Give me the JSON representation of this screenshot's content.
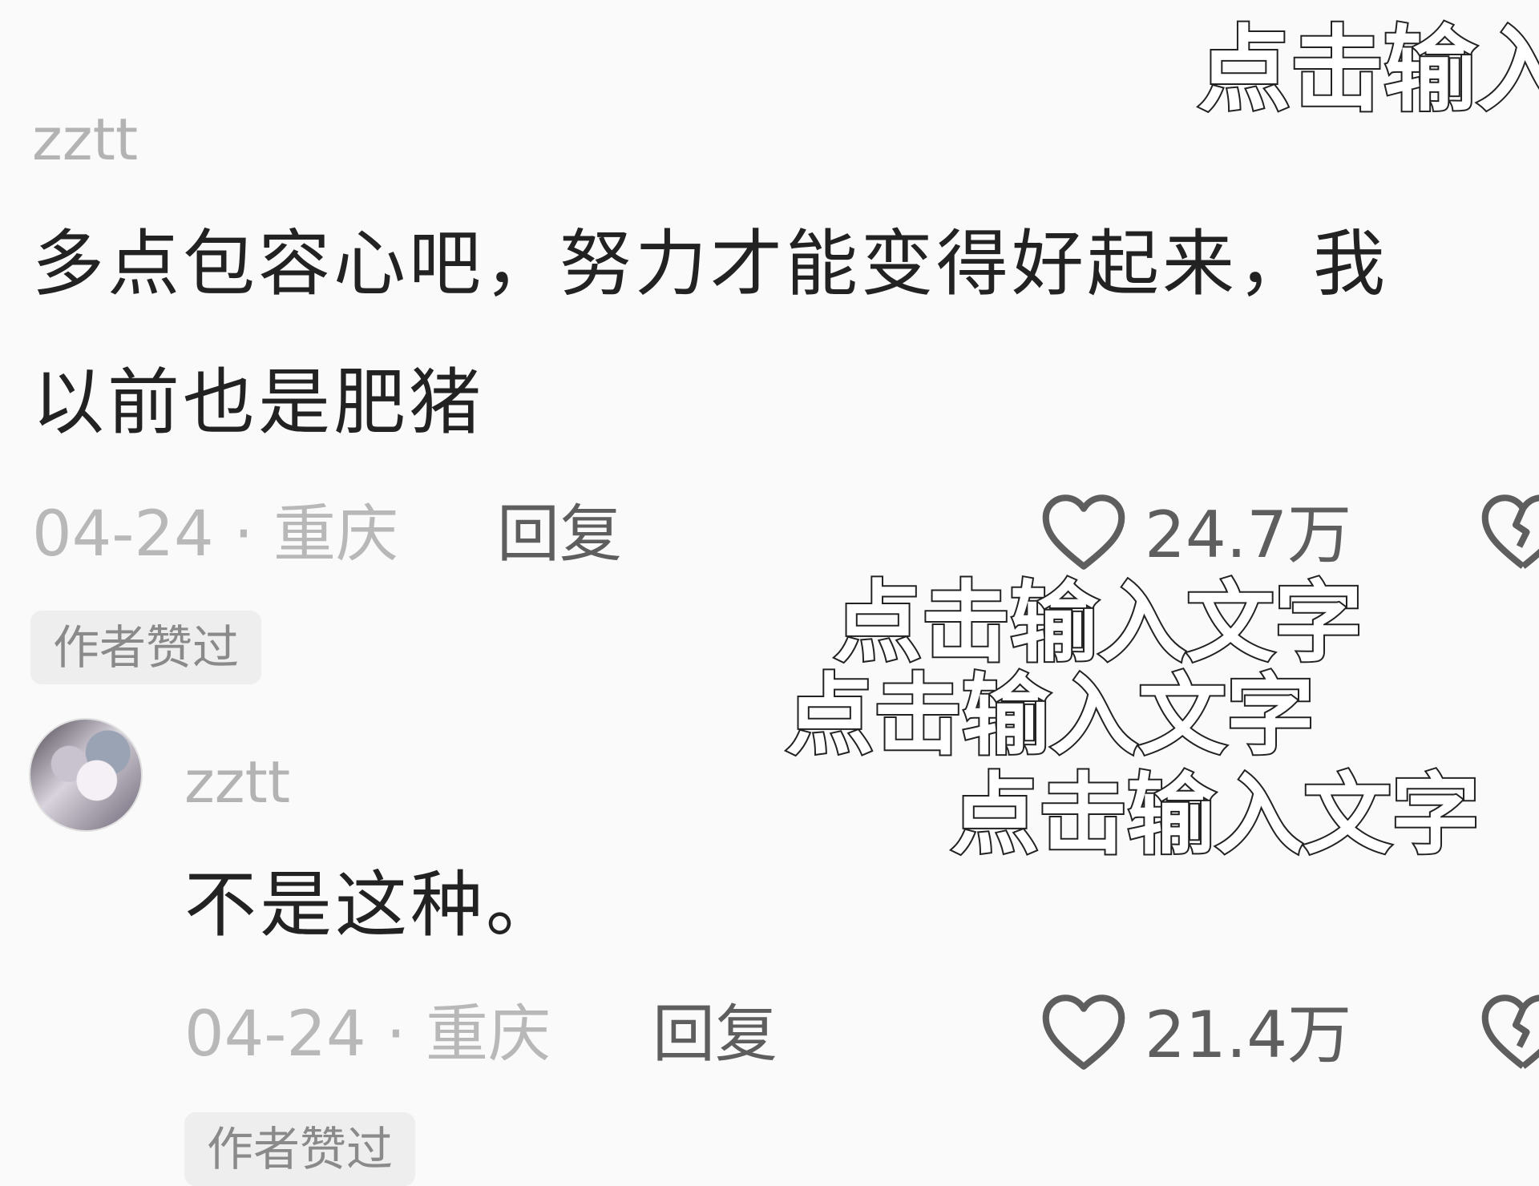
{
  "comment1": {
    "username": "zztt",
    "text_line1": "多点包容心吧，努力才能变得好起来，我",
    "text_line2": "以前也是肥猪",
    "date": "04-24",
    "separator": "·",
    "location": "重庆",
    "reply_label": "回复",
    "like_count": "24.7万",
    "author_badge": "作者赞过"
  },
  "comment2": {
    "username": "zztt",
    "text": "不是这种。",
    "date": "04-24",
    "separator": "·",
    "location": "重庆",
    "reply_label": "回复",
    "like_count": "21.4万",
    "author_badge": "作者赞过"
  },
  "overlays": {
    "top_right": "点击输入",
    "line1": "点击输入文字",
    "line2": "点击输入文字",
    "line3": "点击输入文字"
  },
  "icons": {
    "like": "heart-outline-icon",
    "dislike": "broken-heart-icon"
  },
  "colors": {
    "background": "#fafafa",
    "text_primary": "#222222",
    "text_muted": "#b3b3b3",
    "badge_bg": "#eeeeee"
  }
}
